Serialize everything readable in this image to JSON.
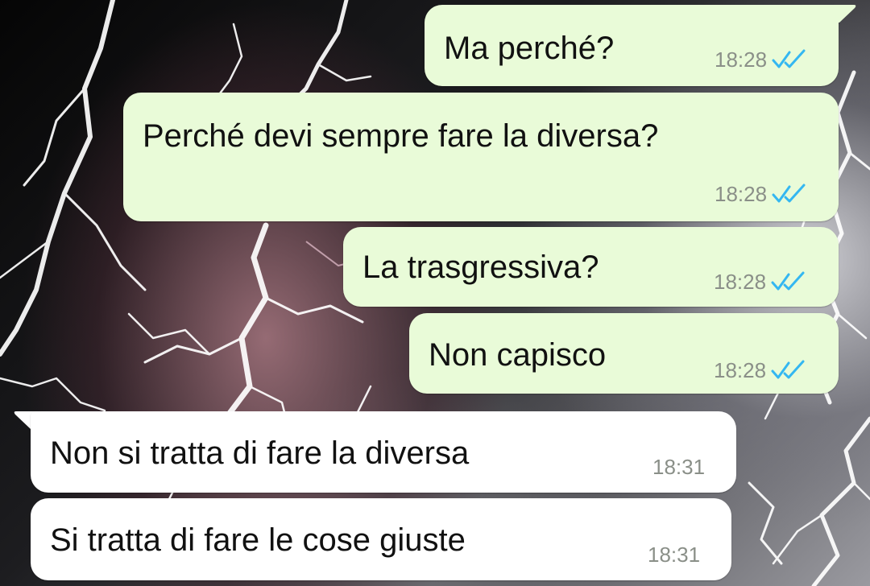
{
  "chat": {
    "messages": [
      {
        "text": "Ma perché?",
        "time": "18:28",
        "direction": "outgoing",
        "status": "read-double-tick"
      },
      {
        "text": "Perché devi sempre fare la diversa?",
        "time": "18:28",
        "direction": "outgoing",
        "status": "read-double-tick"
      },
      {
        "text": "La trasgressiva?",
        "time": "18:28",
        "direction": "outgoing",
        "status": "read-double-tick"
      },
      {
        "text": "Non capisco",
        "time": "18:28",
        "direction": "outgoing",
        "status": "read-double-tick"
      },
      {
        "text": "Non si tratta di fare la diversa",
        "time": "18:31",
        "direction": "incoming"
      },
      {
        "text": "Si tratta di fare le cose giuste",
        "time": "18:31",
        "direction": "incoming"
      }
    ]
  },
  "colors": {
    "outgoing_bubble": "#e9fbd8",
    "incoming_bubble": "#ffffff",
    "read_tick": "#34b7f1",
    "timestamp": "#8a8f88"
  },
  "icons": {
    "read_status": "double-check-icon",
    "background": "lightning-wallpaper"
  }
}
